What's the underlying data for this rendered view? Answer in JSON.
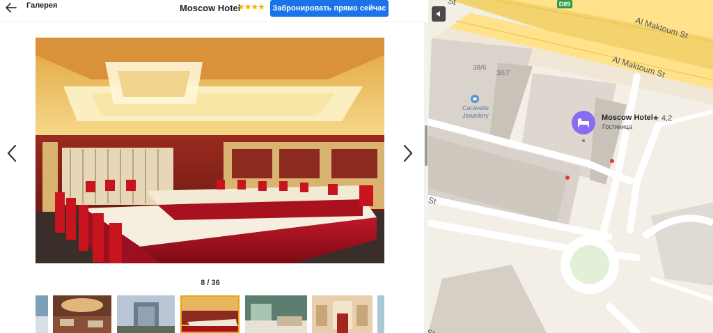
{
  "header": {
    "gallery_label": "Галерея",
    "hotel_name": "Moscow Hotel",
    "stars": "★★★★",
    "book_button": "Забронировать прямо сейчас"
  },
  "gallery": {
    "counter": "8 / 36",
    "current_index": 8,
    "total": 36
  },
  "map": {
    "road_badge": "D89",
    "streets": [
      "St",
      "Al Maktoum St",
      "Al Maktoum St",
      "St",
      "St"
    ],
    "buildings": [
      "38/6",
      "38/7"
    ],
    "poi": {
      "name": "Caravelle Jewellery"
    },
    "hotel": {
      "name": "Moscow Hotel",
      "rating": "★ 4,2",
      "type": "Гостиница"
    }
  },
  "colors": {
    "accent": "#1a73e8",
    "star": "#f5b400",
    "pin": "#8a6cf2"
  }
}
